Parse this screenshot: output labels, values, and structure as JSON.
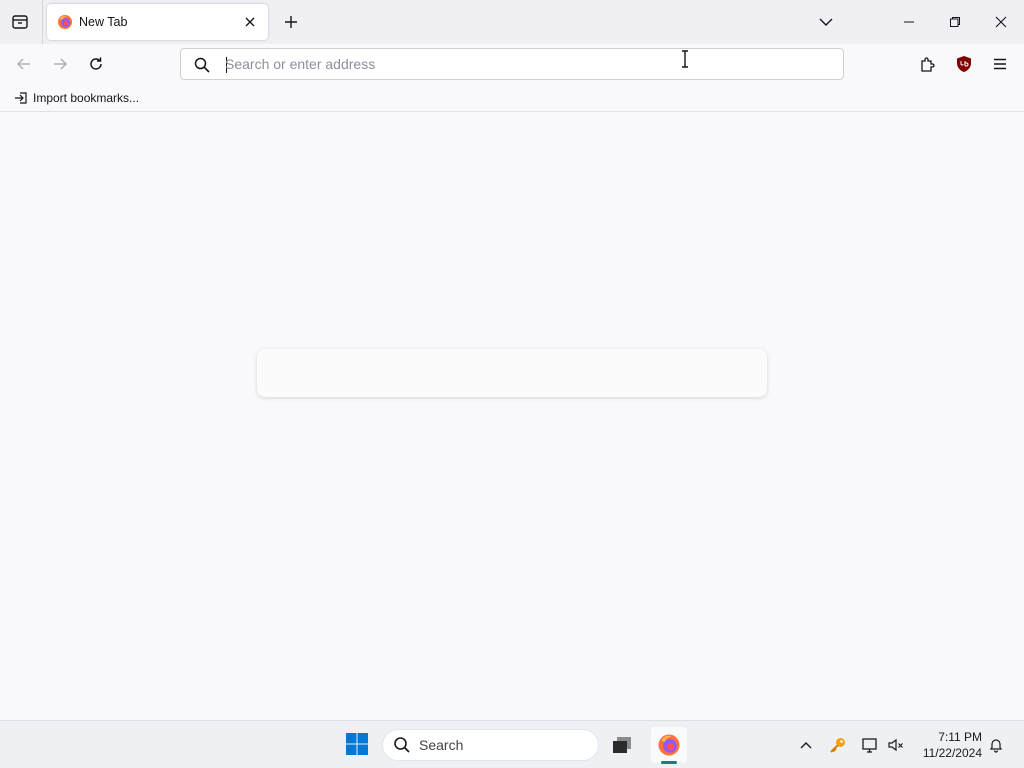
{
  "tabs": [
    {
      "title": "New Tab",
      "favicon": "firefox-icon"
    }
  ],
  "toolbar": {
    "address_placeholder": "Search or enter address",
    "address_value": ""
  },
  "bookmarks": {
    "items": [
      {
        "label": "Import bookmarks...",
        "icon": "import-icon"
      }
    ]
  },
  "taskbar": {
    "search_label": "Search",
    "clock_time": "7:11 PM",
    "clock_date": "11/22/2024",
    "apps": [
      "start-icon",
      "task-view-icon",
      "firefox-icon"
    ]
  },
  "colors": {
    "accent": "#1a7f74",
    "tab_strip": "#f0f0f4",
    "page_bg": "#f9f9fb",
    "ublock_red": "#800000"
  }
}
